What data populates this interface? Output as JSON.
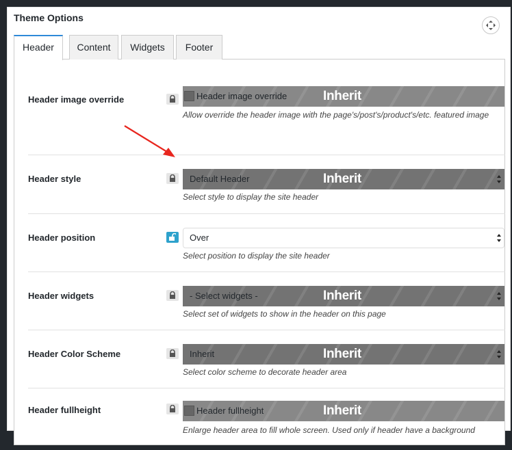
{
  "panel": {
    "title": "Theme Options"
  },
  "tabs": [
    {
      "label": "Header",
      "active": true
    },
    {
      "label": "Content",
      "active": false
    },
    {
      "label": "Widgets",
      "active": false
    },
    {
      "label": "Footer",
      "active": false
    }
  ],
  "inherit_label": "Inherit",
  "colors": {
    "tab_accent": "#2e89d8",
    "inherit_overlay": "#737373",
    "unlocked_lock": "#2ea2cc",
    "annotation_arrow": "#e8261e"
  },
  "rows": {
    "header_image_override": {
      "label": "Header image override",
      "checkbox_label": "Header image override",
      "description": "Allow override the header image with the page's/post's/product's/etc. featured image",
      "locked": true
    },
    "header_style": {
      "label": "Header style",
      "value": "Default Header",
      "description": "Select style to display the site header",
      "locked": true
    },
    "header_position": {
      "label": "Header position",
      "value": "Over",
      "description": "Select position to display the site header",
      "locked": false
    },
    "header_widgets": {
      "label": "Header widgets",
      "value": "- Select widgets -",
      "description": "Select set of widgets to show in the header on this page",
      "locked": true
    },
    "header_color_scheme": {
      "label": "Header Color Scheme",
      "value": "Inherit",
      "description": "Select color scheme to decorate header area",
      "locked": true
    },
    "header_fullheight": {
      "label": "Header fullheight",
      "checkbox_label": "Header fullheight",
      "description": "Enlarge header area to fill whole screen. Used only if header have a background",
      "locked": true
    }
  }
}
